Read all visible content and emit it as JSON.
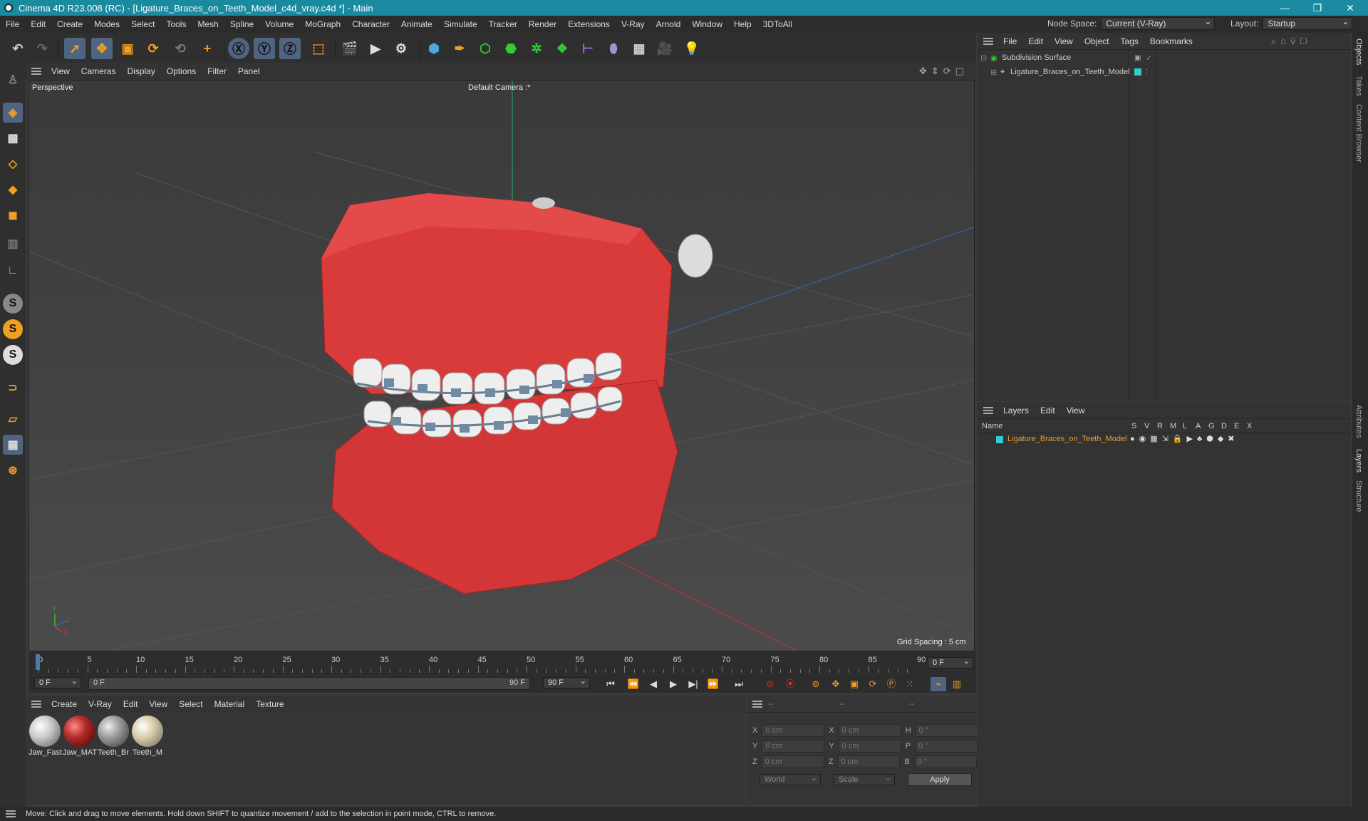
{
  "app": {
    "title": "Cinema 4D R23.008 (RC) - [Ligature_Braces_on_Teeth_Model_c4d_vray.c4d *] - Main"
  },
  "menu": {
    "items": [
      "File",
      "Edit",
      "Create",
      "Modes",
      "Select",
      "Tools",
      "Mesh",
      "Spline",
      "Volume",
      "MoGraph",
      "Character",
      "Animate",
      "Simulate",
      "Tracker",
      "Render",
      "Extensions",
      "V-Ray",
      "Arnold",
      "Window",
      "Help",
      "3DToAll"
    ],
    "node_space_label": "Node Space:",
    "node_space_value": "Current (V-Ray)",
    "layout_label": "Layout:",
    "layout_value": "Startup"
  },
  "viewport": {
    "menu": [
      "View",
      "Cameras",
      "Display",
      "Options",
      "Filter",
      "Panel"
    ],
    "label": "Perspective",
    "camera": "Default Camera :*",
    "grid_spacing": "Grid Spacing : 5 cm",
    "axis_y": "Y",
    "axis_z": "Z",
    "axis_x": "X"
  },
  "timeline": {
    "ticks": [
      "0",
      "5",
      "10",
      "15",
      "20",
      "25",
      "30",
      "35",
      "40",
      "45",
      "50",
      "55",
      "60",
      "65",
      "70",
      "75",
      "80",
      "85",
      "90"
    ],
    "current_frame": "0 F",
    "start_field": "0 F",
    "range_start": "0 F",
    "range_end": "90 F",
    "end_field": "90 F"
  },
  "materials": {
    "menu": [
      "Create",
      "V-Ray",
      "Edit",
      "View",
      "Select",
      "Material",
      "Texture"
    ],
    "items": [
      {
        "name": "Jaw_Fast",
        "color": "#c8c8c8"
      },
      {
        "name": "Jaw_MAT",
        "color": "#b22a2a"
      },
      {
        "name": "Teeth_Br",
        "color": "#9a9a9a"
      },
      {
        "name": "Teeth_M",
        "color": "#d8cba8"
      }
    ]
  },
  "coords": {
    "head": [
      "--",
      "--",
      "--"
    ],
    "rows": [
      {
        "l1": "X",
        "v1": "0 cm",
        "l2": "X",
        "v2": "0 cm",
        "l3": "H",
        "v3": "0 °"
      },
      {
        "l1": "Y",
        "v1": "0 cm",
        "l2": "Y",
        "v2": "0 cm",
        "l3": "P",
        "v3": "0 °"
      },
      {
        "l1": "Z",
        "v1": "0 cm",
        "l2": "Z",
        "v2": "0 cm",
        "l3": "B",
        "v3": "0 °"
      }
    ],
    "mode": "World",
    "transform": "Scale",
    "apply": "Apply"
  },
  "objects": {
    "menu": [
      "File",
      "Edit",
      "View",
      "Object",
      "Tags",
      "Bookmarks"
    ],
    "items": [
      {
        "name": "Subdivision Surface"
      },
      {
        "name": "Ligature_Braces_on_Teeth_Model"
      }
    ]
  },
  "layers": {
    "menu": [
      "Layers",
      "Edit",
      "View"
    ],
    "col_name": "Name",
    "cols": [
      "S",
      "V",
      "R",
      "M",
      "L",
      "A",
      "G",
      "D",
      "E",
      "X"
    ],
    "items": [
      {
        "name": "Ligature_Braces_on_Teeth_Model",
        "color": "#e8a030"
      }
    ]
  },
  "right_tabs": [
    "Objects",
    "Takes",
    "Content Browser",
    "Attributes",
    "Layers",
    "Structure"
  ],
  "status": "Move: Click and drag to move elements. Hold down SHIFT to quantize movement / add to the selection in point mode, CTRL to remove."
}
